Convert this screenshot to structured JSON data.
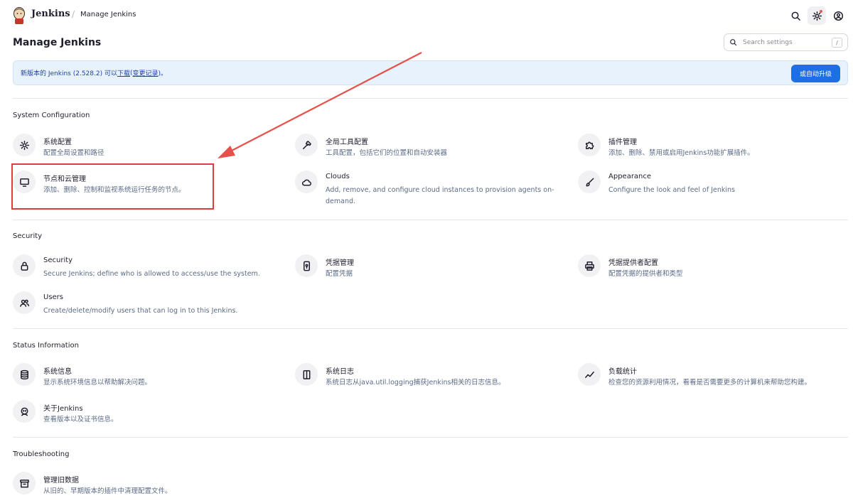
{
  "header": {
    "brand": "Jenkins",
    "breadcrumb_separator": "/",
    "breadcrumb": "Manage Jenkins",
    "icons": [
      "search-icon",
      "gear-icon",
      "user-icon"
    ]
  },
  "page": {
    "title": "Manage Jenkins",
    "search_placeholder": "Search settings",
    "search_shortcut": "/"
  },
  "notice": {
    "text_before": "新版本的 Jenkins (2.528.2) 可以",
    "download_link": "下载",
    "text_mid": " (",
    "changelog_link": "变更记录",
    "text_after": ")。",
    "button": "或自动升级"
  },
  "sections": {
    "system": {
      "title": "System Configuration",
      "items": [
        {
          "title": "系统配置",
          "desc": "配置全局设置和路径",
          "icon": "gear-icon"
        },
        {
          "title": "全局工具配置",
          "desc": "工具配置，包括它们的位置和自动安装器",
          "icon": "hammer-icon"
        },
        {
          "title": "插件管理",
          "desc": "添加、删除、禁用或启用Jenkins功能扩展插件。",
          "icon": "puzzle-icon"
        },
        {
          "title": "节点和云管理",
          "desc": "添加、删除、控制和监视系统运行任务的节点。",
          "icon": "monitor-icon"
        },
        {
          "title": "Clouds",
          "desc": "Add, remove, and configure cloud instances to provision agents on-demand.",
          "icon": "cloud-icon"
        },
        {
          "title": "Appearance",
          "desc": "Configure the look and feel of Jenkins",
          "icon": "brush-icon"
        }
      ]
    },
    "security": {
      "title": "Security",
      "items": [
        {
          "title": "Security",
          "desc": "Secure Jenkins; define who is allowed to access/use the system.",
          "icon": "lock-icon"
        },
        {
          "title": "凭据管理",
          "desc": "配置凭据",
          "icon": "phone-key-icon"
        },
        {
          "title": "凭据提供者配置",
          "desc": "配置凭据的提供者和类型",
          "icon": "printer-icon"
        },
        {
          "title": "Users",
          "desc": "Create/delete/modify users that can log in to this Jenkins.",
          "icon": "users-icon"
        }
      ]
    },
    "status": {
      "title": "Status Information",
      "items": [
        {
          "title": "系统信息",
          "desc": "显示系统环境信息以帮助解决问题。",
          "icon": "database-icon"
        },
        {
          "title": "系统日志",
          "desc": "系统日志从java.util.logging捕获Jenkins相关的日志信息。",
          "icon": "log-icon"
        },
        {
          "title": "负载统计",
          "desc": "检查您的资源利用情况，看看是否需要更多的计算机来帮助您构建。",
          "icon": "trend-icon"
        },
        {
          "title": "关于Jenkins",
          "desc": "查看版本以及证书信息。",
          "icon": "jenkins-head-icon"
        }
      ]
    },
    "troubleshooting": {
      "title": "Troubleshooting",
      "items": [
        {
          "title": "管理旧数据",
          "desc": "从旧的、早期版本的插件中清理配置文件。",
          "icon": "archive-icon"
        }
      ]
    }
  },
  "annotation": {
    "highlight_color": "#e23b3b"
  }
}
